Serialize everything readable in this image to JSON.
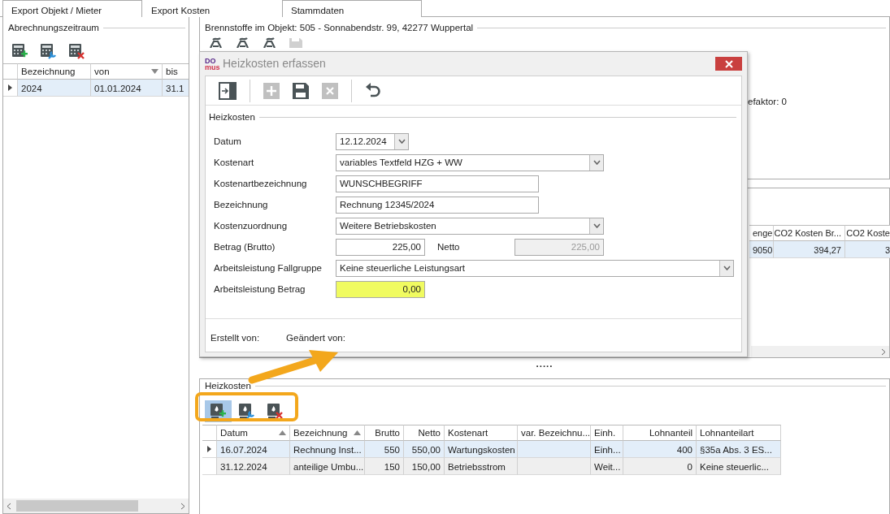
{
  "tabs": [
    {
      "label": "Export Objekt / Mieter",
      "selected": false
    },
    {
      "label": "Export Kosten",
      "selected": true
    },
    {
      "label": "Stammdaten",
      "selected": false
    }
  ],
  "period_panel": {
    "title": "Abrechnungszeitraum",
    "toolbar": [
      {
        "kind": "add"
      },
      {
        "kind": "edit"
      },
      {
        "kind": "delete"
      }
    ],
    "grid": {
      "columns": [
        {
          "label": "Bezeichnung",
          "sorted_ascending": false,
          "sorted_descending": false
        },
        {
          "label": "von",
          "sorted_ascending": false,
          "sorted_descending": true
        },
        {
          "label": "bis",
          "sorted_ascending": false,
          "sorted_descending": false
        }
      ],
      "rows": [
        {
          "selected": true,
          "cells": [
            "2024",
            "01.01.2024",
            "31.1"
          ]
        }
      ]
    }
  },
  "fuel_panel": {
    "title": "Brennstoffe im Objekt: 505 - Sonnabendstr. 99, 42277 Wuppertal",
    "info": "efaktor: 0",
    "grid": {
      "columns": [
        {
          "label": "enge"
        },
        {
          "label": "CO2 Kosten Br..."
        },
        {
          "label": "CO2 Koste"
        }
      ],
      "rows": [
        {
          "selected": true,
          "cells": [
            "9050",
            "394,27",
            "3"
          ]
        }
      ]
    }
  },
  "splitter": ".....",
  "costs_panel": {
    "title": "Heizkosten",
    "toolbar": [
      {
        "kind": "add",
        "selected": true
      },
      {
        "kind": "edit",
        "selected": false
      },
      {
        "kind": "delete",
        "selected": false
      }
    ],
    "grid": {
      "columns": [
        {
          "label": "Datum",
          "sorted_ascending": true,
          "sorted_descending": false
        },
        {
          "label": "Bezeichnung",
          "sorted_ascending": true,
          "sorted_descending": false
        },
        {
          "label": "Brutto",
          "sorted_ascending": false,
          "sorted_descending": false
        },
        {
          "label": "Netto",
          "sorted_ascending": false,
          "sorted_descending": false
        },
        {
          "label": "Kostenart",
          "sorted_ascending": false,
          "sorted_descending": false
        },
        {
          "label": "var. Bezeichnu...",
          "sorted_ascending": false,
          "sorted_descending": false
        },
        {
          "label": "Einh.",
          "sorted_ascending": false,
          "sorted_descending": false
        },
        {
          "label": "Lohnanteil",
          "sorted_ascending": false,
          "sorted_descending": false
        },
        {
          "label": "Lohnanteilart",
          "sorted_ascending": false,
          "sorted_descending": false
        }
      ],
      "rows": [
        {
          "selected": true,
          "cells": [
            "16.07.2024",
            "Rechnung Inst...",
            "550",
            "550,00",
            "Wartungskosten",
            "",
            "Einh...",
            "400",
            "§35a Abs. 3 ES..."
          ]
        },
        {
          "selected": false,
          "cells": [
            "31.12.2024",
            "anteilige Umbu...",
            "150",
            "150,00",
            "Betriebsstrom",
            "",
            "Weit...",
            "0",
            "Keine steuerlic..."
          ]
        }
      ]
    }
  },
  "dialog": {
    "logo_top": "DO",
    "logo_bottom": "mus",
    "title": "Heizkosten erfassen",
    "toolbar": [
      {
        "kind": "exit",
        "disabled": false
      },
      {
        "kind": "add",
        "disabled": true
      },
      {
        "kind": "save",
        "disabled": false
      },
      {
        "kind": "delete",
        "disabled": true
      },
      {
        "kind": "undo",
        "disabled": false
      }
    ],
    "group_title": "Heizkosten",
    "fields": [
      {
        "label": "Datum",
        "kind": "date",
        "value": "12.12.2024"
      },
      {
        "label": "Kostenart",
        "kind": "select",
        "value": "variables Textfeld HZG + WW"
      },
      {
        "label": "Kostenartbezeichnung",
        "kind": "text",
        "value": "WUNSCHBEGRIFF"
      },
      {
        "label": "Bezeichnung",
        "kind": "text",
        "value": "Rechnung 12345/2024"
      },
      {
        "label": "Kostenzuordnung",
        "kind": "select",
        "value": "Weitere Betriebskosten"
      },
      {
        "label": "Betrag (Brutto)",
        "kind": "amount",
        "value": "225,00",
        "extra": {
          "label": "Netto",
          "value": "225,00",
          "disabled": true
        }
      },
      {
        "label": "Arbeitsleistung Fallgruppe",
        "kind": "select_wide",
        "value": "Keine steuerliche Leistungsart"
      },
      {
        "label": "Arbeitsleistung Betrag",
        "kind": "amount",
        "value": "0,00",
        "highlighted": true
      }
    ],
    "footer": [
      "Erstellt von:",
      "Geändert von:"
    ]
  }
}
